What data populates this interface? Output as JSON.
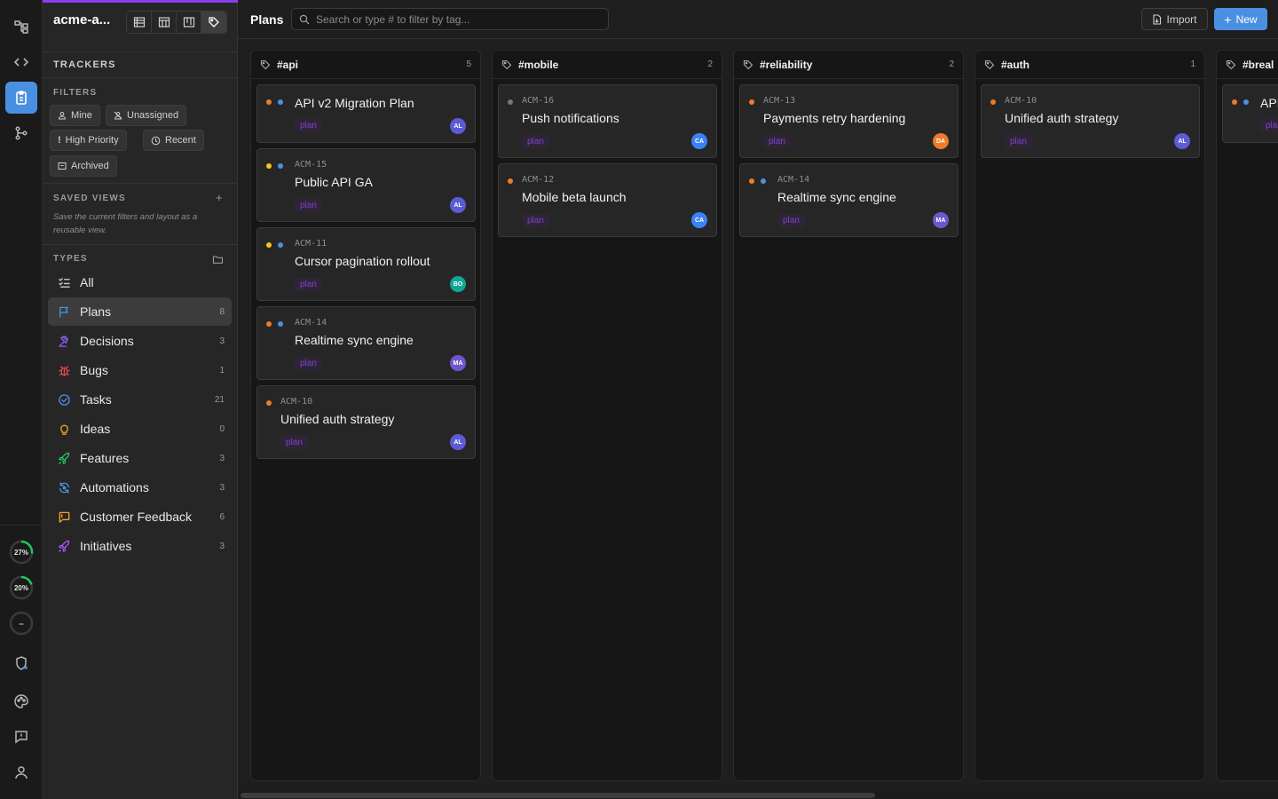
{
  "workspace": {
    "name": "acme-a..."
  },
  "sidebar": {
    "trackers_label": "TRACKERS",
    "filters_label": "FILTERS",
    "filters": [
      "Mine",
      "Unassigned",
      "High Priority",
      "Recent",
      "Archived"
    ],
    "saved_views_label": "SAVED VIEWS",
    "saved_views_add": "+",
    "saved_views_desc": "Save the current filters and layout as a reusable view.",
    "types_label": "TYPES",
    "types": [
      {
        "label": "All",
        "count": "",
        "icon": "list-check-icon",
        "color": "#cfcfcf"
      },
      {
        "label": "Plans",
        "count": "8",
        "icon": "flag-icon",
        "color": "#4a90e2"
      },
      {
        "label": "Decisions",
        "count": "3",
        "icon": "gavel-icon",
        "color": "#8b5cf6"
      },
      {
        "label": "Bugs",
        "count": "1",
        "icon": "bug-icon",
        "color": "#e5484d"
      },
      {
        "label": "Tasks",
        "count": "21",
        "icon": "check-circle-icon",
        "color": "#4a90e2"
      },
      {
        "label": "Ideas",
        "count": "0",
        "icon": "lightbulb-icon",
        "color": "#f5a524"
      },
      {
        "label": "Features",
        "count": "3",
        "icon": "rocket-icon",
        "color": "#22c55e"
      },
      {
        "label": "Automations",
        "count": "3",
        "icon": "refresh-icon",
        "color": "#4a90e2"
      },
      {
        "label": "Customer Feedback",
        "count": "6",
        "icon": "message-square-icon",
        "color": "#f5a524"
      },
      {
        "label": "Initiatives",
        "count": "3",
        "icon": "rocket-icon",
        "color": "#a855f7"
      }
    ]
  },
  "rail": {
    "progress": [
      {
        "label": "27%",
        "value": 0.27
      },
      {
        "label": "20%",
        "value": 0.2
      },
      {
        "label": "--",
        "value": 0
      }
    ]
  },
  "header": {
    "title": "Plans",
    "search_placeholder": "Search or type # to filter by tag...",
    "import_label": "Import",
    "new_label": "New"
  },
  "columns": [
    {
      "title": "#api",
      "count": "5",
      "cards": [
        {
          "id": "",
          "title": "API v2 Migration Plan",
          "tag": "plan",
          "avatar": "AL",
          "dots": [
            "#f07a2b",
            "#4a90e2"
          ]
        },
        {
          "id": "ACM-15",
          "title": "Public API GA",
          "tag": "plan",
          "avatar": "AL",
          "dots": [
            "#f5c518",
            "#4a90e2"
          ]
        },
        {
          "id": "ACM-11",
          "title": "Cursor pagination rollout",
          "tag": "plan",
          "avatar": "BO",
          "dots": [
            "#f5c518",
            "#4a90e2"
          ]
        },
        {
          "id": "ACM-14",
          "title": "Realtime sync engine",
          "tag": "plan",
          "avatar": "MA",
          "dots": [
            "#f07a2b",
            "#4a90e2"
          ]
        },
        {
          "id": "ACM-10",
          "title": "Unified auth strategy",
          "tag": "plan",
          "avatar": "AL",
          "dots": [
            "#f07a2b"
          ]
        }
      ]
    },
    {
      "title": "#mobile",
      "count": "2",
      "cards": [
        {
          "id": "ACM-16",
          "title": "Push notifications",
          "tag": "plan",
          "avatar": "CA",
          "dots": [
            "#777777"
          ]
        },
        {
          "id": "ACM-12",
          "title": "Mobile beta launch",
          "tag": "plan",
          "avatar": "CA",
          "dots": [
            "#f07a2b"
          ]
        }
      ]
    },
    {
      "title": "#reliability",
      "count": "2",
      "cards": [
        {
          "id": "ACM-13",
          "title": "Payments retry hardening",
          "tag": "plan",
          "avatar": "DA",
          "dots": [
            "#f07a2b"
          ]
        },
        {
          "id": "ACM-14",
          "title": "Realtime sync engine",
          "tag": "plan",
          "avatar": "MA",
          "dots": [
            "#f07a2b",
            "#4a90e2"
          ]
        }
      ]
    },
    {
      "title": "#auth",
      "count": "1",
      "cards": [
        {
          "id": "ACM-10",
          "title": "Unified auth strategy",
          "tag": "plan",
          "avatar": "AL",
          "dots": [
            "#f07a2b"
          ]
        }
      ]
    },
    {
      "title": "#breal",
      "count": "",
      "cards": [
        {
          "id": "",
          "title": "API",
          "tag": "pla",
          "avatar": "",
          "dots": [
            "#f07a2b",
            "#4a90e2"
          ]
        }
      ]
    }
  ],
  "avatar_colors": {
    "AL": "#5b5bd6",
    "BO": "#12a594",
    "MA": "#6e56cf",
    "CA": "#3b82f6",
    "DA": "#f07a2b"
  }
}
